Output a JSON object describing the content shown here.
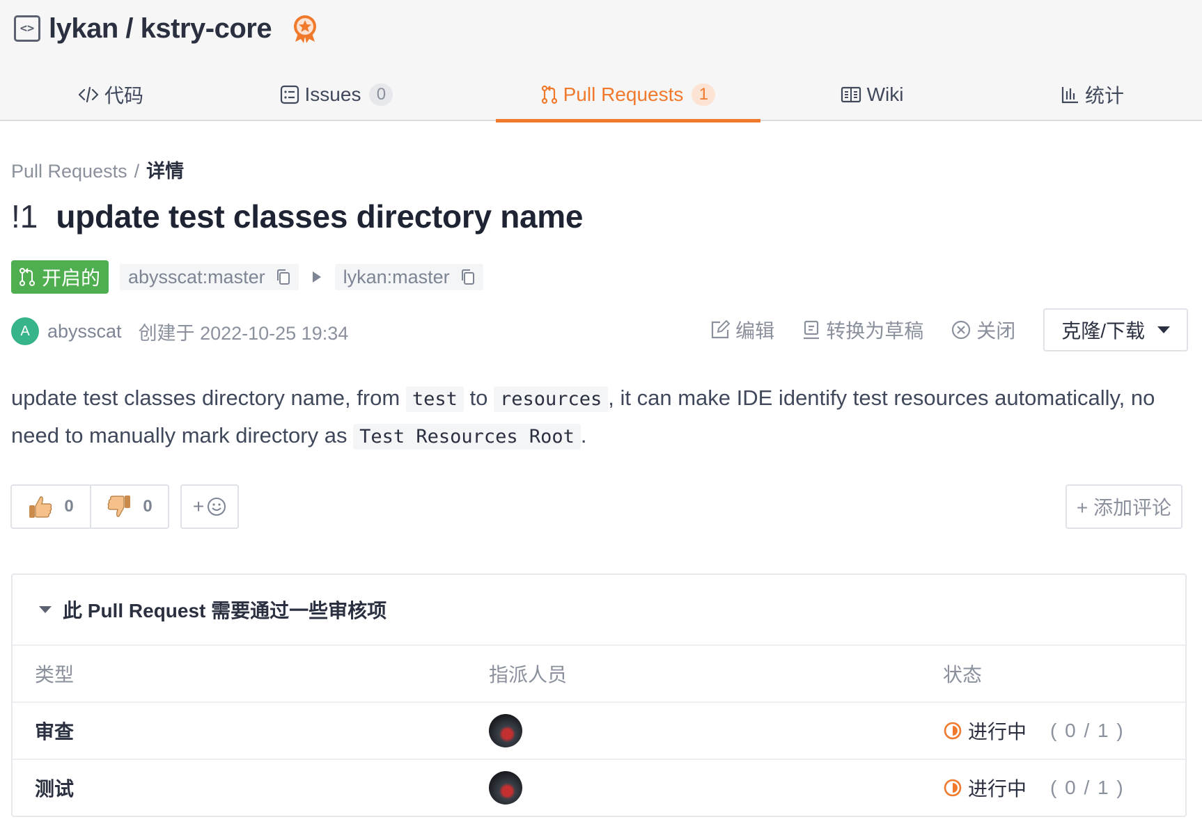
{
  "repo": {
    "owner": "lykan",
    "name": "kstry-core",
    "title": "lykan / kstry-core"
  },
  "tabs": [
    {
      "label": "代码",
      "icon": "code-icon",
      "count": null
    },
    {
      "label": "Issues",
      "icon": "issues-icon",
      "count": "0"
    },
    {
      "label": "Pull Requests",
      "icon": "pull-request-icon",
      "count": "1",
      "active": true
    },
    {
      "label": "Wiki",
      "icon": "wiki-icon",
      "count": null
    },
    {
      "label": "统计",
      "icon": "stats-icon",
      "count": null
    }
  ],
  "breadcrumb": {
    "parent": "Pull Requests",
    "separator": "/",
    "current": "详情"
  },
  "pr": {
    "number": "!1",
    "title": "update test classes directory name",
    "state": "开启的",
    "source_branch": "abysscat:master",
    "target_branch": "lykan:master",
    "author": "abysscat",
    "author_initial": "A",
    "created": "创建于 2022-10-25 19:34"
  },
  "actions": {
    "edit": "编辑",
    "draft": "转换为草稿",
    "close": "关闭",
    "clone": "克隆/下载"
  },
  "description": {
    "p1": "update test classes directory name, from ",
    "code1": "test",
    "p2": " to ",
    "code2": "resources",
    "p3": ", it can make IDE identify test resources automatically, no need to manually mark directory as ",
    "code3": "Test Resources Root",
    "p4": "."
  },
  "reactions": {
    "thumbs_up": "0",
    "thumbs_down": "0",
    "add_emoji": "+"
  },
  "add_comment": "+ 添加评论",
  "review": {
    "heading": "此 Pull Request 需要通过一些审核项",
    "columns": [
      "类型",
      "指派人员",
      "状态"
    ],
    "rows": [
      {
        "type": "审查",
        "status": "进行中",
        "progress": "( 0 / 1 )"
      },
      {
        "type": "测试",
        "status": "进行中",
        "progress": "( 0 / 1 )"
      }
    ]
  },
  "colors": {
    "accent": "#f0792c",
    "open_green": "#4fae4f",
    "avatar_green": "#38b48b"
  }
}
